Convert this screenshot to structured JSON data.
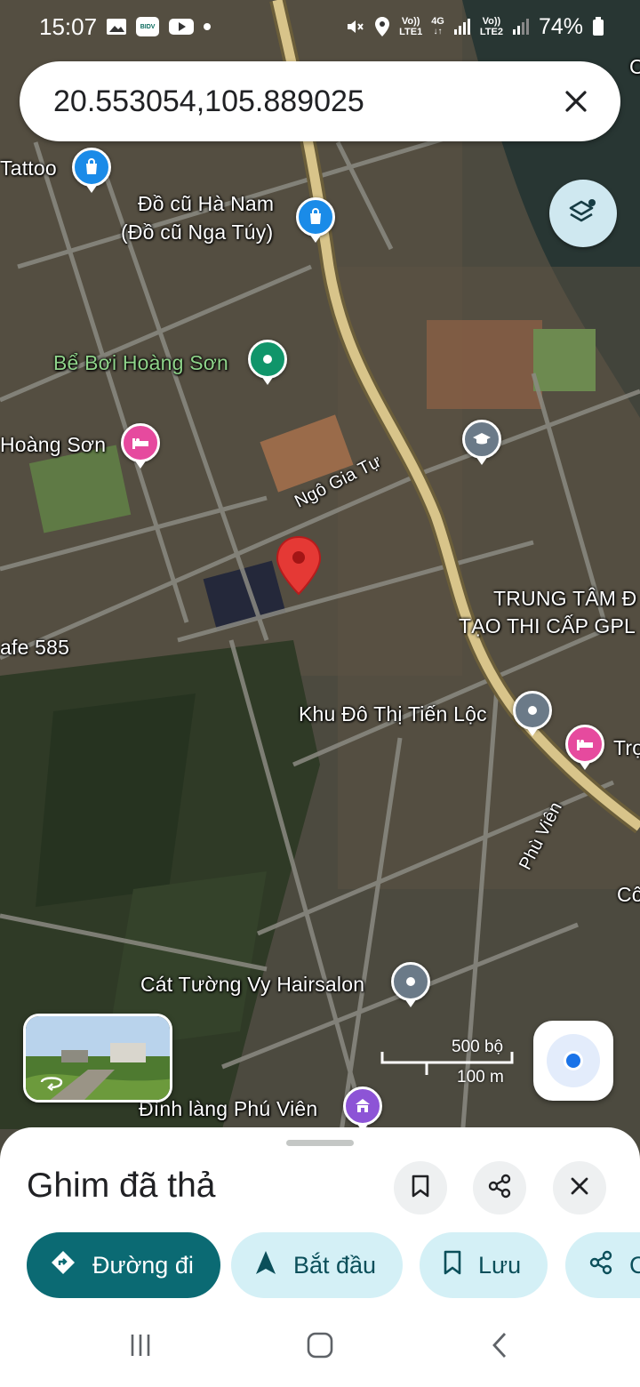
{
  "status_bar": {
    "time": "15:07",
    "bidv_label": "BIDV",
    "sim1_top": "Vo))",
    "sim1_bottom": "LTE1",
    "net_top": "4G",
    "sim2_top": "Vo))",
    "sim2_bottom": "LTE2",
    "battery": "74%"
  },
  "search": {
    "query": "20.553054,105.889025"
  },
  "map": {
    "labels": {
      "tattoo": "Tattoo",
      "do_cu_1": "Đồ cũ Hà Nam",
      "do_cu_2": "(Đồ cũ Nga Túy)",
      "be_boi": "Bể Bơi Hoàng Sơn",
      "hoang_son": "Hoàng Sơn",
      "ngo_gia_tu": "Ngô Gia Tự",
      "trung_tam_1": "TRUNG TÂM Đ",
      "trung_tam_2": "TẠO THI CẤP GPL",
      "cafe": "afe 585",
      "khu_do_thi": "Khu Đô Thị Tiến Lộc",
      "tro": "Trọ",
      "phu_vien": "Phù Viên",
      "co": "Cô",
      "hairsalon": "Cát Tường Vy Hairsalon",
      "dinh_lang": "Đình làng Phú Viên",
      "corner_c": "C"
    },
    "icons": [
      "shopping-bag-icon",
      "hotel-icon",
      "school-icon",
      "pool-icon",
      "place-icon",
      "temple-icon"
    ]
  },
  "scale": {
    "feet": "500 bộ",
    "meters": "100 m"
  },
  "sheet": {
    "title": "Ghim đã thả",
    "chips": {
      "directions": "Đường đi",
      "start": "Bắt đầu",
      "save": "Lưu",
      "share": "C"
    }
  },
  "colors": {
    "primary_chip": "#0b6a73",
    "chip_bg": "#d4f0f6",
    "pin": "#e53935",
    "location_dot": "#1a73e8"
  }
}
